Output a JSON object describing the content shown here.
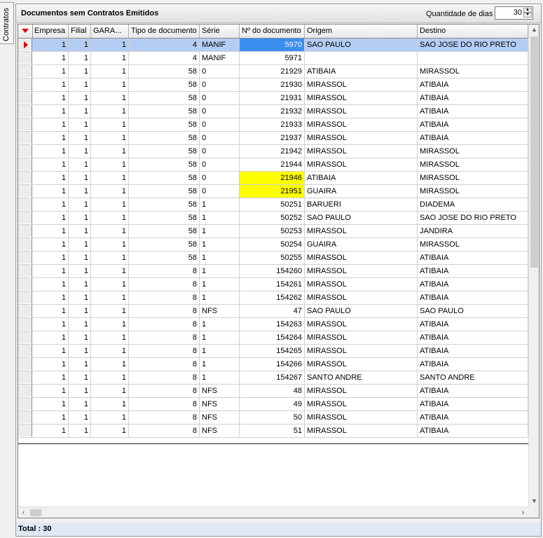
{
  "side_tab": {
    "label": "Contratos"
  },
  "panel": {
    "title": "Documentos sem Contratos Emitidos",
    "days_label": "Quantidade de dias",
    "days_value": "30"
  },
  "grid": {
    "columns": [
      "Empresa",
      "Filial",
      "GARA...",
      "Tipo de documento",
      "Série",
      "Nº do documento",
      "Origem",
      "Destino"
    ],
    "rows": [
      [
        "1",
        "1",
        "1",
        "4",
        "MANIF",
        "5970",
        "SAO PAULO",
        "SAO JOSE DO RIO PRETO"
      ],
      [
        "1",
        "1",
        "1",
        "4",
        "MANIF",
        "5971",
        "",
        ""
      ],
      [
        "1",
        "1",
        "1",
        "58",
        "0",
        "21929",
        "ATIBAIA",
        "MIRASSOL"
      ],
      [
        "1",
        "1",
        "1",
        "58",
        "0",
        "21930",
        "MIRASSOL",
        "ATIBAIA"
      ],
      [
        "1",
        "1",
        "1",
        "58",
        "0",
        "21931",
        "MIRASSOL",
        "ATIBAIA"
      ],
      [
        "1",
        "1",
        "1",
        "58",
        "0",
        "21932",
        "MIRASSOL",
        "ATIBAIA"
      ],
      [
        "1",
        "1",
        "1",
        "58",
        "0",
        "21933",
        "MIRASSOL",
        "ATIBAIA"
      ],
      [
        "1",
        "1",
        "1",
        "58",
        "0",
        "21937",
        "MIRASSOL",
        "ATIBAIA"
      ],
      [
        "1",
        "1",
        "1",
        "58",
        "0",
        "21942",
        "MIRASSOL",
        "MIRASSOL"
      ],
      [
        "1",
        "1",
        "1",
        "58",
        "0",
        "21944",
        "MIRASSOL",
        "MIRASSOL"
      ],
      [
        "1",
        "1",
        "1",
        "58",
        "0",
        "21946",
        "ATIBAIA",
        "MIRASSOL"
      ],
      [
        "1",
        "1",
        "1",
        "58",
        "0",
        "21951",
        "GUAIRA",
        "MIRASSOL"
      ],
      [
        "1",
        "1",
        "1",
        "58",
        "1",
        "50251",
        "BARUERI",
        "DIADEMA"
      ],
      [
        "1",
        "1",
        "1",
        "58",
        "1",
        "50252",
        "SAO PAULO",
        "SAO JOSE DO RIO PRETO"
      ],
      [
        "1",
        "1",
        "1",
        "58",
        "1",
        "50253",
        "MIRASSOL",
        "JANDIRA"
      ],
      [
        "1",
        "1",
        "1",
        "58",
        "1",
        "50254",
        "GUAIRA",
        "MIRASSOL"
      ],
      [
        "1",
        "1",
        "1",
        "58",
        "1",
        "50255",
        "MIRASSOL",
        "ATIBAIA"
      ],
      [
        "1",
        "1",
        "1",
        "8",
        "1",
        "154260",
        "MIRASSOL",
        "ATIBAIA"
      ],
      [
        "1",
        "1",
        "1",
        "8",
        "1",
        "154261",
        "MIRASSOL",
        "ATIBAIA"
      ],
      [
        "1",
        "1",
        "1",
        "8",
        "1",
        "154262",
        "MIRASSOL",
        "ATIBAIA"
      ],
      [
        "1",
        "1",
        "1",
        "8",
        "NFS",
        "47",
        "SAO PAULO",
        "SAO PAULO"
      ],
      [
        "1",
        "1",
        "1",
        "8",
        "1",
        "154263",
        "MIRASSOL",
        "ATIBAIA"
      ],
      [
        "1",
        "1",
        "1",
        "8",
        "1",
        "154264",
        "MIRASSOL",
        "ATIBAIA"
      ],
      [
        "1",
        "1",
        "1",
        "8",
        "1",
        "154265",
        "MIRASSOL",
        "ATIBAIA"
      ],
      [
        "1",
        "1",
        "1",
        "8",
        "1",
        "154266",
        "MIRASSOL",
        "ATIBAIA"
      ],
      [
        "1",
        "1",
        "1",
        "8",
        "1",
        "154267",
        "SANTO ANDRE",
        "SANTO ANDRE"
      ],
      [
        "1",
        "1",
        "1",
        "8",
        "NFS",
        "48",
        "MIRASSOL",
        "ATIBAIA"
      ],
      [
        "1",
        "1",
        "1",
        "8",
        "NFS",
        "49",
        "MIRASSOL",
        "ATIBAIA"
      ],
      [
        "1",
        "1",
        "1",
        "8",
        "NFS",
        "50",
        "MIRASSOL",
        "ATIBAIA"
      ],
      [
        "1",
        "1",
        "1",
        "8",
        "NFS",
        "51",
        "MIRASSOL",
        "ATIBAIA"
      ]
    ],
    "selected_row": 0,
    "highlighted_rows": [
      10,
      11
    ],
    "highlight_color": "#ffff00",
    "selection_color": "#3a8ef0"
  },
  "footer": {
    "total": "Total : 30"
  }
}
